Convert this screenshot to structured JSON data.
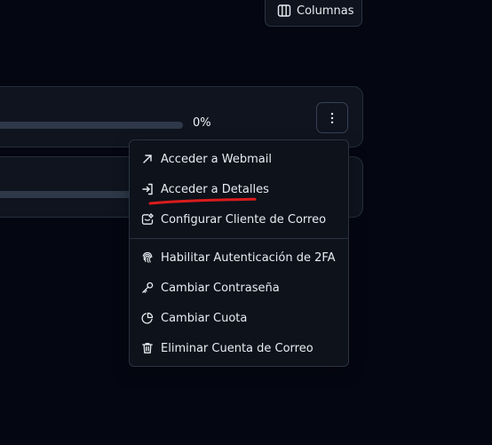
{
  "toolbar": {
    "columns_label": "Columnas",
    "columns_icon": "columns-icon"
  },
  "cards": [
    {
      "progress_value": 0,
      "progress_label": "0%",
      "menu_icon": "more-vertical-icon"
    },
    {
      "progress_value": 0
    }
  ],
  "menu": {
    "items": [
      {
        "label": "Acceder a Webmail",
        "icon": "external-link-icon"
      },
      {
        "label": "Acceder a Detalles",
        "icon": "log-in-icon"
      },
      {
        "label": "Configurar Cliente de Correo",
        "icon": "mail-settings-icon"
      },
      {
        "label": "Habilitar Autenticación de 2FA",
        "icon": "fingerprint-icon"
      },
      {
        "label": "Cambiar Contraseña",
        "icon": "key-icon"
      },
      {
        "label": "Cambiar Cuota",
        "icon": "pie-chart-icon"
      },
      {
        "label": "Eliminar Cuenta de Correo",
        "icon": "trash-icon"
      }
    ]
  },
  "colors": {
    "background": "#040612",
    "card": "#0f141f",
    "border": "#262f3c",
    "text": "#e8ecf3",
    "annotation": "#d91c1c"
  }
}
